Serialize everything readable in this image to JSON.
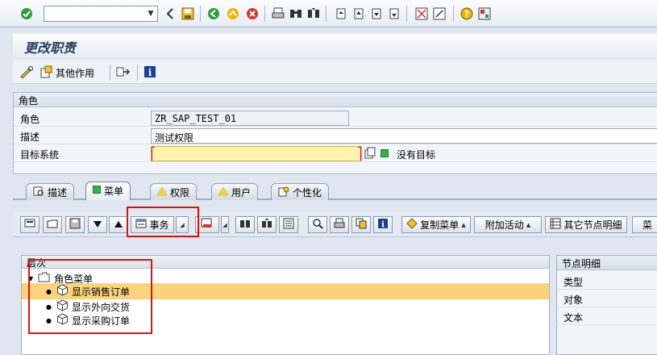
{
  "title": "更改职责",
  "app_toolbar": {
    "other_functions_label": "其他作用"
  },
  "group": {
    "header": "角色",
    "rows": [
      {
        "label": "角色",
        "value": "ZR_SAP_TEST_01"
      },
      {
        "label": "描述",
        "value": "测试权限"
      },
      {
        "label": "目标系统",
        "value": ""
      }
    ],
    "no_target_label": "没有目标"
  },
  "tabs": [
    {
      "label": "描述",
      "icon": "description-icon",
      "state": "normal"
    },
    {
      "label": "菜单",
      "icon": "green-square-icon",
      "state": "active"
    },
    {
      "label": "权限",
      "icon": "yellow-triangle-icon",
      "state": "normal"
    },
    {
      "label": "用户",
      "icon": "yellow-triangle-icon",
      "state": "normal"
    },
    {
      "label": "个性化",
      "icon": "personalization-icon",
      "state": "normal"
    }
  ],
  "tree_toolbar": {
    "transaction_label": "事务",
    "copy_menu_label": "复制菜单",
    "additional_activities_label": "附加活动",
    "other_node_details_label": "其它节点明细",
    "menu_truncated_label": "菜"
  },
  "tree": {
    "header": "层次",
    "root": "角色菜单",
    "items": [
      {
        "label": "显示销售订单",
        "selected": true
      },
      {
        "label": "显示外向交货",
        "selected": false
      },
      {
        "label": "显示采购订单",
        "selected": false
      }
    ]
  },
  "details": {
    "header": "节点明细",
    "rows": [
      "类型",
      "对象",
      "文本"
    ]
  },
  "colors": {
    "accent_selected": "#fcd37c",
    "required_field": "#fff3ad",
    "highlight_frame": "#e01010",
    "status_green": "#2db44a"
  }
}
